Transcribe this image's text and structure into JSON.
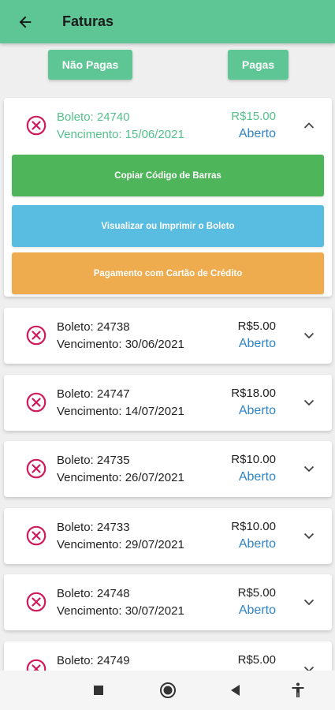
{
  "appbar": {
    "title": "Faturas",
    "back_icon": "arrow-back-icon"
  },
  "filters": {
    "nao_pagas": "Não Pagas",
    "pagas": "Pagas"
  },
  "colors": {
    "primary": "#5ec694",
    "status_icon": "#d0195b",
    "status_text": "#2f84c4",
    "expanded_text": "#55c08a",
    "btn_barcode": "#4fb55a",
    "btn_view": "#59bde2",
    "btn_card": "#eeac4f"
  },
  "expanded_actions": {
    "copy_barcode": "Copiar Código de Barras",
    "view_print": "Visualizar ou Imprimir o Boleto",
    "credit_card": "Pagamento com Cartão de Crédito"
  },
  "invoices": [
    {
      "boleto": "Boleto: 24740",
      "vencimento": "Vencimento: 15/06/2021",
      "valor": "R$15.00",
      "status": "Aberto",
      "expanded": true
    },
    {
      "boleto": "Boleto: 24738",
      "vencimento": "Vencimento: 30/06/2021",
      "valor": "R$5.00",
      "status": "Aberto",
      "expanded": false
    },
    {
      "boleto": "Boleto: 24747",
      "vencimento": "Vencimento: 14/07/2021",
      "valor": "R$18.00",
      "status": "Aberto",
      "expanded": false
    },
    {
      "boleto": "Boleto: 24735",
      "vencimento": "Vencimento: 26/07/2021",
      "valor": "R$10.00",
      "status": "Aberto",
      "expanded": false
    },
    {
      "boleto": "Boleto: 24733",
      "vencimento": "Vencimento: 29/07/2021",
      "valor": "R$10.00",
      "status": "Aberto",
      "expanded": false
    },
    {
      "boleto": "Boleto: 24748",
      "vencimento": "Vencimento: 30/07/2021",
      "valor": "R$5.00",
      "status": "Aberto",
      "expanded": false
    },
    {
      "boleto": "Boleto: 24749",
      "vencimento": "",
      "valor": "R$5.00",
      "status": "",
      "expanded": false
    }
  ],
  "navbar": {
    "icons": [
      "recents-square-icon",
      "home-circle-icon",
      "back-triangle-icon",
      "accessibility-icon"
    ]
  }
}
